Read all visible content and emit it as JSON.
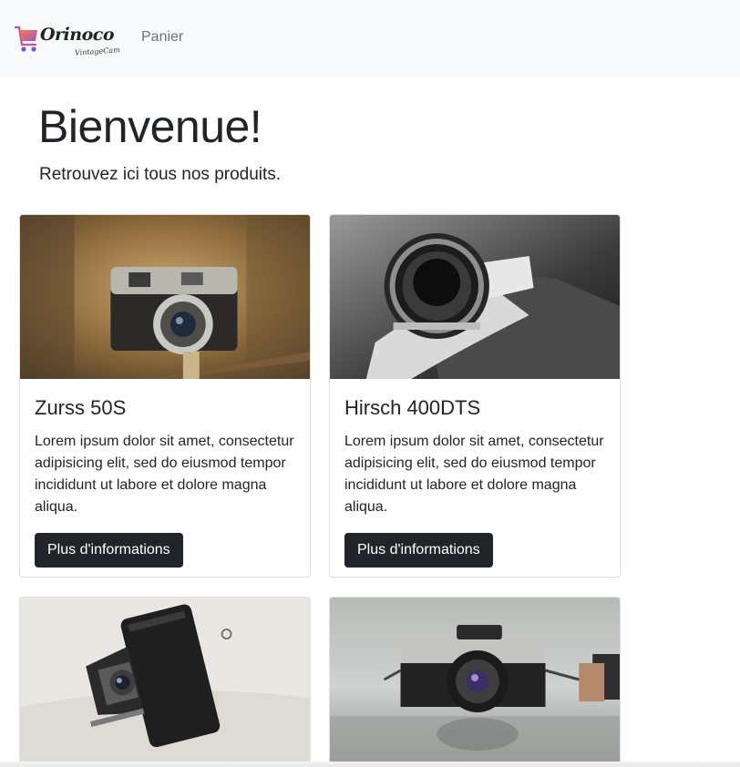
{
  "navbar": {
    "brand_name": "Orinoco",
    "brand_tagline": "VintageCam",
    "links": [
      {
        "label": "Panier"
      }
    ]
  },
  "hero": {
    "title": "Bienvenue!",
    "lead": "Retrouvez ici tous nos produits."
  },
  "products": [
    {
      "name": "Zurss 50S",
      "description": "Lorem ipsum dolor sit amet, consectetur adipisicing elit, sed do eiusmod tempor incididunt ut labore et dolore magna aliqua.",
      "button_label": "Plus d'informations"
    },
    {
      "name": "Hirsch 400DTS",
      "description": "Lorem ipsum dolor sit amet, consectetur adipisicing elit, sed do eiusmod tempor incididunt ut labore et dolore magna aliqua.",
      "button_label": "Plus d'informations"
    },
    {
      "name": "",
      "description": "",
      "button_label": ""
    },
    {
      "name": "",
      "description": "",
      "button_label": ""
    }
  ],
  "colors": {
    "navbar_bg": "#f8f9fa",
    "button_dark": "#212529",
    "nav_link": "#6c757d",
    "brand_cart_gradient": [
      "#ff7a3d",
      "#9b59d0"
    ]
  },
  "icons": {
    "brand_logo": "shopping-cart-icon"
  }
}
